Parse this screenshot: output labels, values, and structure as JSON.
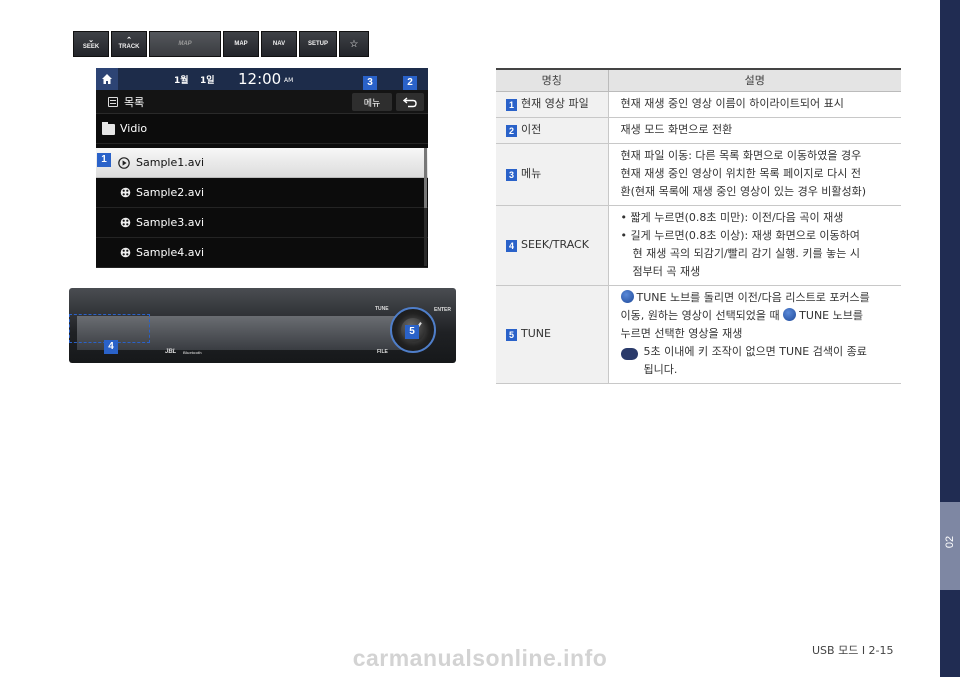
{
  "screen": {
    "date_month": "1월",
    "date_day": "1일",
    "time": "12:00",
    "ampm": "AM",
    "title": "목록",
    "menu_label": "메뉴",
    "folder": "Vidio",
    "files": [
      "Sample1.avi",
      "Sample2.avi",
      "Sample3.avi",
      "Sample4.avi"
    ],
    "callouts": [
      "1",
      "2",
      "3",
      "4",
      "5"
    ]
  },
  "panel": {
    "seek": "SEEK",
    "track": "TRACK",
    "map_logo": "MAP",
    "map": "MAP",
    "nav": "NAV",
    "setup": "SETUP",
    "star": "☆",
    "tune": "TUNE",
    "enter": "ENTER",
    "file": "FILE",
    "jbl": "JBL",
    "bluetooth": "Bluetooth"
  },
  "table": {
    "header_name": "명칭",
    "header_desc": "설명",
    "rows": [
      {
        "num": "1",
        "name": "현재 영상 파일",
        "desc": "현재 재생 중인 영상 이름이 하이라이트되어 표시"
      },
      {
        "num": "2",
        "name": "이전",
        "desc": "재생 모드 화면으로 전환"
      },
      {
        "num": "3",
        "name": "메뉴",
        "desc_lines": [
          "현재 파일 이동: 다른 목록 화면으로 이동하였을 경우",
          "현재 재생 중인 영상이 위치한 목록 페이지로 다시 전",
          "환(현재 목록에 재생 중인 영상이 있는 경우 비활성화)"
        ]
      },
      {
        "num": "4",
        "name": "SEEK/TRACK",
        "bullets": [
          "• 짧게 누르면(0.8초 미만): 이전/다음 곡이 재생",
          "• 길게 누르면(0.8초 이상): 재생 화면으로 이동하여",
          "현 재생 곡의 되감기/빨리 감기 실행. 키를 놓는 시",
          "점부터 곡 재생"
        ]
      },
      {
        "num": "5",
        "name": "TUNE",
        "line1": "TUNE 노브를 돌리면 이전/다음 리스트로 포커스를",
        "line2a": "이동, 원하는 영상이 선택되었을 때",
        "line2b": "TUNE 노브를",
        "line3": "누르면 선택한 영상을 재생",
        "info": "i",
        "note1": "5초 이내에 키 조작이 없으면 TUNE 검색이 종료",
        "note2": "됩니다."
      }
    ]
  },
  "chapter": "02",
  "footer": "USB 모드 I 2-15",
  "watermark": "carmanualsonline.info"
}
